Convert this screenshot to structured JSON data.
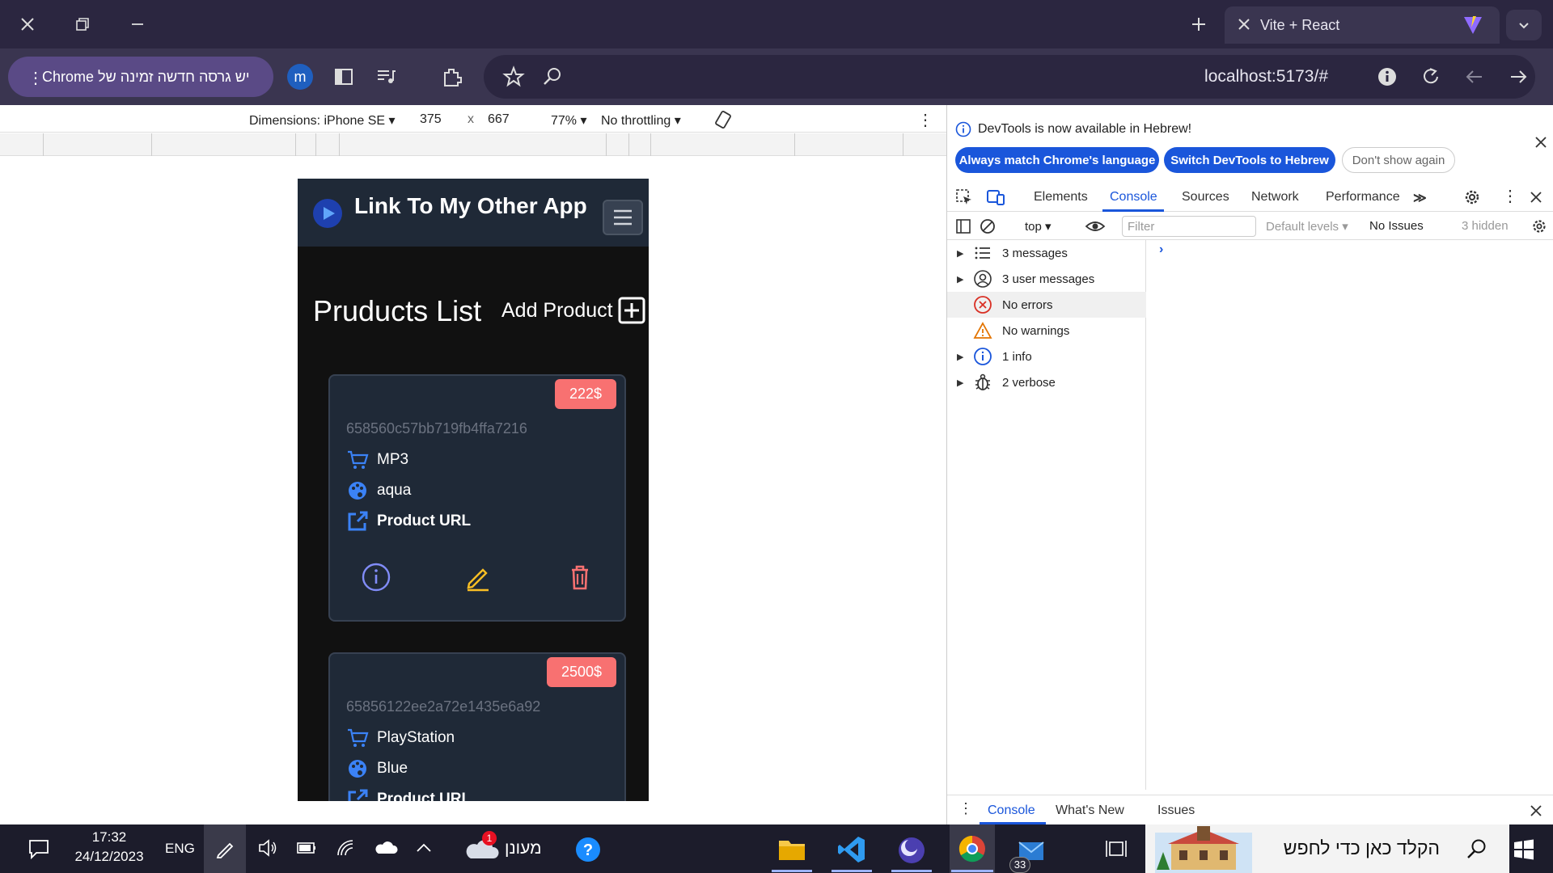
{
  "browser": {
    "tab_title": "Vite + React",
    "update_chip": "יש גרסה חדשה זמינה של Chrome",
    "profile_initial": "m",
    "url": "localhost:5173/#"
  },
  "device_toolbar": {
    "dimensions": "Dimensions: iPhone SE",
    "width": "375",
    "times": "x",
    "height": "667",
    "zoom": "77%",
    "throttling": "No throttling"
  },
  "app": {
    "title": "Link To My Other App",
    "list_title": "Pruducts List",
    "add_product": "Add Product",
    "products": [
      {
        "price": "222$",
        "id": "658560c57bb719fb4ffa7216",
        "name": "MP3",
        "color": "aqua",
        "url_label": "Product URL"
      },
      {
        "price": "2500$",
        "id": "65856122ee2a72e1435e6a92",
        "name": "PlayStation",
        "color": "Blue",
        "url_label": "Product URL"
      }
    ]
  },
  "devtools": {
    "info": "DevTools is now available in Hebrew!",
    "btn_match": "Always match Chrome's language",
    "btn_switch": "Switch DevTools to Hebrew",
    "btn_dont_show": "Don't show again",
    "tabs": [
      "Elements",
      "Console",
      "Sources",
      "Network",
      "Performance"
    ],
    "context": "top",
    "filter_placeholder": "Filter",
    "levels": "Default levels",
    "issues": "No Issues",
    "hidden": "3 hidden",
    "sidebar": [
      "3 messages",
      "3 user messages",
      "No errors",
      "No warnings",
      "1 info",
      "2 verbose"
    ],
    "drawer_tabs": [
      "Console",
      "What's New",
      "Issues"
    ]
  },
  "taskbar": {
    "time": "17:32",
    "date": "24/12/2023",
    "lang": "ENG",
    "weather": "מעונן",
    "mail_badge": "33",
    "weather_badge": "1",
    "search_text": "הקלד כאן כדי לחפש"
  }
}
